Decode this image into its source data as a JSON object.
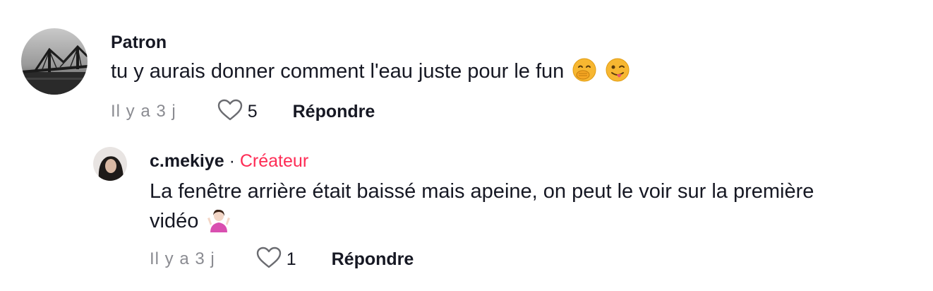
{
  "comments": [
    {
      "username": "Patron",
      "text": "tu y aurais donner comment l'eau juste pour le fun",
      "emojis": [
        "face-with-hand-over-mouth-icon",
        "winking-face-with-tongue-icon"
      ],
      "time": "Il y a 3 j",
      "likes": "5",
      "reply_label": "Répondre"
    }
  ],
  "replies": [
    {
      "username": "c.mekiye",
      "separator": "·",
      "badge": "Créateur",
      "text_line1": "La fenêtre arrière était baissé mais apeine, on peut le voir sur la première",
      "text_line2": "vidéo",
      "emojis": [
        "person-shrugging-icon"
      ],
      "time": "Il y a 3 j",
      "likes": "1",
      "reply_label": "Répondre"
    }
  ],
  "colors": {
    "text": "#161823",
    "muted": "#8a8b91",
    "creator": "#fe2c55"
  }
}
